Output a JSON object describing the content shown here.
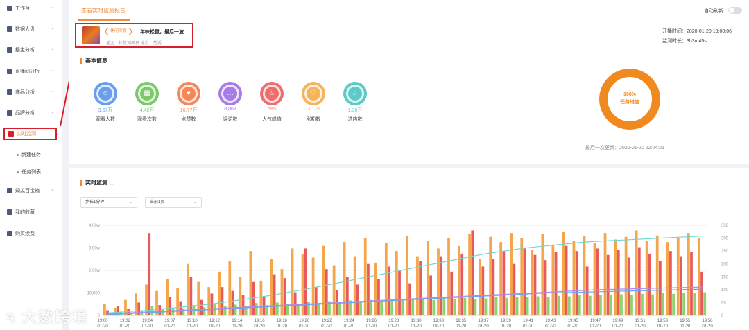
{
  "sidebar": {
    "items": [
      {
        "label": "工作台",
        "icon": "grid-icon",
        "has_chevron": true
      },
      {
        "label": "数据大盘",
        "icon": "pie-icon",
        "has_chevron": true
      },
      {
        "label": "播主分析",
        "icon": "bar-icon",
        "has_chevron": true
      },
      {
        "label": "直播间分析",
        "icon": "live-icon",
        "has_chevron": true
      },
      {
        "label": "商品分析",
        "icon": "goods-icon",
        "has_chevron": true
      },
      {
        "label": "品牌分析",
        "icon": "brand-icon",
        "has_chevron": true
      },
      {
        "label": "实时监测",
        "icon": "monitor-icon",
        "has_chevron": true,
        "active": true
      },
      {
        "label": "知瓜百宝箱",
        "icon": "box-icon",
        "has_chevron": true
      },
      {
        "label": "我的收藏",
        "icon": "bookmark-icon",
        "has_chevron": false
      },
      {
        "label": "购买续费",
        "icon": "vip-icon",
        "has_chevron": false
      }
    ],
    "sub_items": [
      "新建任务",
      "任务列表"
    ]
  },
  "header": {
    "tab": "查看实时监测报告",
    "auto_refresh": "自动刷新"
  },
  "room": {
    "tag": "休闲零食",
    "title": "年味松鼠，最后一波",
    "meta": "播主：松鼠饲养员  地点：芜湖"
  },
  "start": {
    "start_time": "开播时间：2020-01-20 19:00:06",
    "duration": "监测时长：3h3m45s"
  },
  "basic": {
    "title": "基本信息",
    "stats": [
      {
        "value": "3.67万",
        "label": "观看人数",
        "color": "#6a9ff0",
        "icon": "eye-icon"
      },
      {
        "value": "4.42万",
        "label": "观看次数",
        "color": "#7cc96a",
        "icon": "apps-icon"
      },
      {
        "value": "16.77万",
        "label": "点赞数",
        "color": "#f5875a",
        "icon": "thumb-icon"
      },
      {
        "value": "8,069",
        "label": "评论数",
        "color": "#a77be8",
        "icon": "comment-icon"
      },
      {
        "value": "585",
        "label": "人气峰值",
        "color": "#f06d6d",
        "icon": "fire-icon"
      },
      {
        "value": "3,179",
        "label": "涨粉数",
        "color": "#f5b45a",
        "icon": "heart-icon"
      },
      {
        "value": "1.30万",
        "label": "进店数",
        "color": "#5acbc6",
        "icon": "store-icon"
      }
    ],
    "progress_pct": "100%",
    "progress_label": "任务进度",
    "progress_fraction": 1.0,
    "last_update": "最后一次更新：2020-01-20 22:04:21"
  },
  "realtime": {
    "title": "实时监测",
    "step_select": "步长1分钟",
    "page_select": "当前1页"
  },
  "watermark": "大数跨境",
  "chart_data": {
    "type": "bar",
    "y_left_ticks": [
      "0",
      "10,000",
      "2.00w",
      "3.00w",
      "4.00w"
    ],
    "y_right_ticks": [
      "0",
      "50",
      "100",
      "150",
      "200",
      "250",
      "300",
      "350"
    ],
    "ylim_left": [
      0,
      40000
    ],
    "ylim_right": [
      0,
      350
    ],
    "x_ticks": [
      {
        "time": "19:00",
        "date": "01-20"
      },
      {
        "time": "19:02",
        "date": "01-20"
      },
      {
        "time": "19:04",
        "date": "01-20"
      },
      {
        "time": "19:07",
        "date": "01-20"
      },
      {
        "time": "19:10",
        "date": "01-20"
      },
      {
        "time": "19:12",
        "date": "01-20"
      },
      {
        "time": "19:14",
        "date": "01-20"
      },
      {
        "time": "19:16",
        "date": "01-20"
      },
      {
        "time": "19:18",
        "date": "01-20"
      },
      {
        "time": "19:20",
        "date": "01-20"
      },
      {
        "time": "19:22",
        "date": "01-20"
      },
      {
        "time": "19:24",
        "date": "01-20"
      },
      {
        "time": "19:26",
        "date": "01-20"
      },
      {
        "time": "19:28",
        "date": "01-20"
      },
      {
        "time": "19:30",
        "date": "01-20"
      },
      {
        "time": "19:33",
        "date": "01-20"
      },
      {
        "time": "19:35",
        "date": "01-20"
      },
      {
        "time": "19:37",
        "date": "01-20"
      },
      {
        "time": "19:39",
        "date": "01-20"
      },
      {
        "time": "19:41",
        "date": "01-20"
      },
      {
        "time": "19:43",
        "date": "01-20"
      },
      {
        "time": "19:45",
        "date": "01-20"
      },
      {
        "time": "19:47",
        "date": "01-20"
      },
      {
        "time": "19:49",
        "date": "01-20"
      },
      {
        "time": "19:51",
        "date": "01-20"
      },
      {
        "time": "19:53",
        "date": "01-20"
      },
      {
        "time": "19:55",
        "date": "01-20"
      },
      {
        "time": "19:58",
        "date": "01-20"
      }
    ],
    "series": [
      {
        "color": "#f5a54a",
        "axis": "right",
        "values": [
          45,
          30,
          60,
          85,
          120,
          95,
          140,
          105,
          200,
          130,
          110,
          170,
          210,
          150,
          250,
          135,
          220,
          180,
          260,
          240,
          225,
          270,
          195,
          285,
          230,
          300,
          205,
          280,
          250,
          310,
          230,
          290,
          260,
          300,
          270,
          315,
          220,
          305,
          285,
          320,
          300,
          255,
          315,
          275,
          325,
          290,
          310,
          280,
          320,
          295,
          305,
          330,
          290,
          310,
          285,
          300,
          320,
          300
        ]
      },
      {
        "color": "#e85a5a",
        "axis": "right",
        "values": [
          20,
          35,
          25,
          50,
          320,
          40,
          70,
          55,
          150,
          60,
          85,
          110,
          95,
          80,
          130,
          70,
          160,
          145,
          90,
          260,
          110,
          180,
          100,
          150,
          120,
          200,
          140,
          190,
          175,
          125,
          210,
          155,
          230,
          170,
          240,
          330,
          190,
          220,
          250,
          200,
          260,
          235,
          215,
          245,
          270,
          250,
          190,
          260,
          235,
          255,
          225,
          265,
          240,
          210,
          250,
          230,
          245,
          170
        ]
      },
      {
        "color": "#8ed16e",
        "axis": "right",
        "values": [
          10,
          15,
          12,
          20,
          35,
          25,
          30,
          28,
          40,
          32,
          45,
          38,
          42,
          36,
          48,
          40,
          50,
          44,
          46,
          52,
          48,
          55,
          50,
          58,
          54,
          60,
          56,
          62,
          58,
          60,
          64,
          60,
          66,
          62,
          68,
          64,
          66,
          70,
          68,
          72,
          70,
          74,
          72,
          76,
          74,
          78,
          76,
          80,
          78,
          82,
          80,
          84,
          82,
          86,
          84,
          88,
          86,
          90
        ]
      },
      {
        "color": "#6fd6d0",
        "axis": "right",
        "type": "line",
        "values": [
          10,
          12,
          15,
          18,
          20,
          25,
          28,
          32,
          36,
          40,
          45,
          50,
          56,
          62,
          68,
          74,
          80,
          88,
          95,
          102,
          110,
          118,
          126,
          134,
          142,
          150,
          158,
          166,
          174,
          182,
          190,
          198,
          206,
          214,
          222,
          230,
          238,
          244,
          250,
          256,
          262,
          266,
          270,
          274,
          278,
          282,
          286,
          288,
          290,
          292,
          294,
          296,
          298,
          300,
          302,
          304,
          306,
          308
        ]
      },
      {
        "color": "#b08be8",
        "axis": "right",
        "type": "line",
        "values": [
          5,
          8,
          10,
          12,
          14,
          16,
          18,
          20,
          22,
          24,
          26,
          28,
          30,
          32,
          34,
          36,
          38,
          40,
          42,
          44,
          46,
          48,
          50,
          52,
          54,
          56,
          58,
          60,
          62,
          64,
          66,
          68,
          70,
          72,
          74,
          76,
          78,
          80,
          82,
          84,
          86,
          88,
          90,
          92,
          94,
          96,
          98,
          100,
          101,
          102,
          103,
          104,
          105,
          106,
          107,
          108,
          109,
          110
        ]
      },
      {
        "color": "#6fa2f0",
        "axis": "right",
        "type": "line",
        "values": [
          3,
          5,
          7,
          9,
          11,
          13,
          15,
          17,
          19,
          21,
          23,
          25,
          27,
          29,
          31,
          33,
          35,
          37,
          39,
          41,
          43,
          45,
          47,
          49,
          51,
          53,
          55,
          57,
          59,
          61,
          63,
          65,
          67,
          69,
          71,
          73,
          75,
          77,
          79,
          81,
          83,
          85,
          87,
          88,
          89,
          90,
          91,
          92,
          93,
          94,
          95,
          96,
          97,
          98,
          99,
          100,
          101,
          102
        ]
      }
    ]
  }
}
